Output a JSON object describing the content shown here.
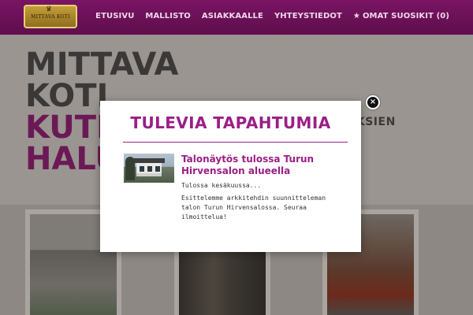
{
  "brand": {
    "logo_text": "MITTAVA KOTI",
    "logo_icon": "crown-icon"
  },
  "nav": {
    "items": [
      "ETUSIVU",
      "MALLISTO",
      "ASIAKKAALLE",
      "YHTEYSTIEDOT"
    ],
    "favorites": {
      "icon": "star-icon",
      "label": "OMAT SUOSIKIT (0)"
    }
  },
  "hero": {
    "lines": [
      "MITTAVA",
      "KOTI",
      "KUTE",
      "HALU"
    ],
    "side_text": "UKSIEN"
  },
  "modal": {
    "title": "TULEVIA TAPAHTUMIA",
    "close_icon": "close-icon",
    "close_glyph": "×",
    "event": {
      "title": "Talonäytös tulossa Turun Hirvensalon alueella",
      "paragraphs": [
        "Tulossa kesäkuussa...",
        "Esittelemme arkkitehdin suunnitteleman talon Turun Hirvensalossa. Seuraa ilmoittelua!"
      ]
    }
  },
  "colors": {
    "header_bg": "#6c1157",
    "accent": "#9b1f86",
    "hero_dark_text": "#3b3938",
    "hero_purple_text": "#6b1956"
  }
}
